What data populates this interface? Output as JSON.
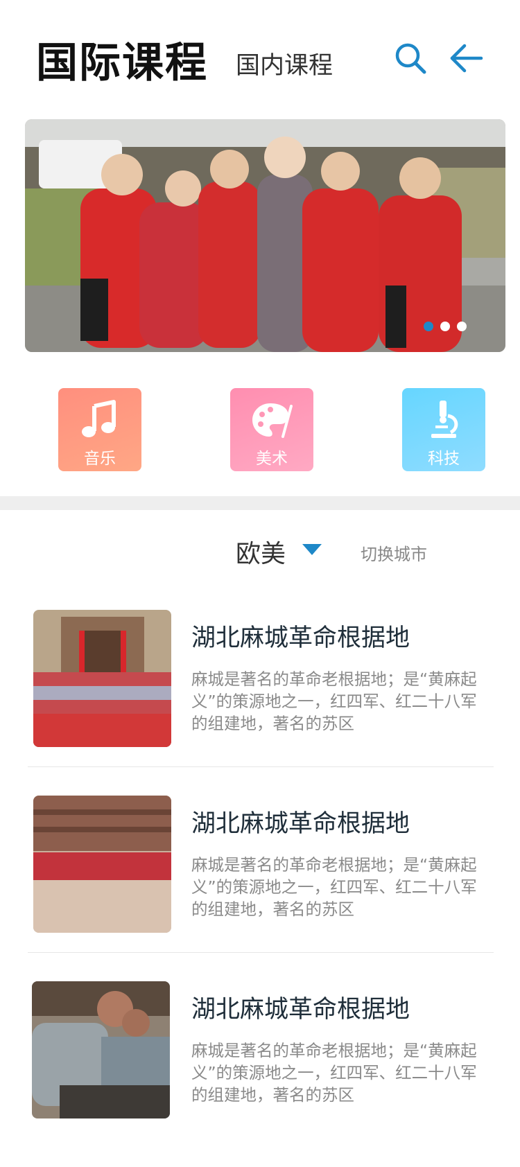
{
  "header": {
    "active_tab": "国际课程",
    "inactive_tab": "国内课程",
    "icons": {
      "search": "search-icon",
      "back": "arrow-left-icon"
    }
  },
  "banner": {
    "slide_count": 3,
    "active_slide": 1
  },
  "categories": [
    {
      "label": "音乐",
      "icon": "music-note-icon"
    },
    {
      "label": "美术",
      "icon": "palette-icon"
    },
    {
      "label": "科技",
      "icon": "microscope-icon"
    }
  ],
  "filter": {
    "region": "欧美",
    "switch_city": "切换城市"
  },
  "courses": [
    {
      "title": "湖北麻城革命根据地",
      "description": "麻城是著名的革命老根据地；是“黄麻起义”的策源地之一，红四军、红二十八军的组建地，著名的苏区"
    },
    {
      "title": "湖北麻城革命根据地",
      "description": "麻城是著名的革命老根据地；是“黄麻起义”的策源地之一，红四军、红二十八军的组建地，著名的苏区"
    },
    {
      "title": "湖北麻城革命根据地",
      "description": "麻城是著名的革命老根据地；是“黄麻起义”的策源地之一，红四军、红二十八军的组建地，著名的苏区"
    }
  ],
  "colors": {
    "accent": "#1e88c8",
    "music": "#ff967f",
    "art": "#ff97b6",
    "tech": "#72d8ff"
  }
}
